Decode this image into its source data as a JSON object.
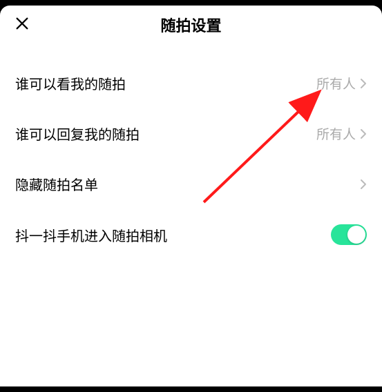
{
  "header": {
    "title": "随拍设置"
  },
  "settings": {
    "view": {
      "label": "谁可以看我的随拍",
      "value": "所有人"
    },
    "reply": {
      "label": "谁可以回复我的随拍",
      "value": "所有人"
    },
    "hidelist": {
      "label": "隐藏随拍名单"
    },
    "shake": {
      "label": "抖一抖手机进入随拍相机",
      "enabled": true
    }
  }
}
